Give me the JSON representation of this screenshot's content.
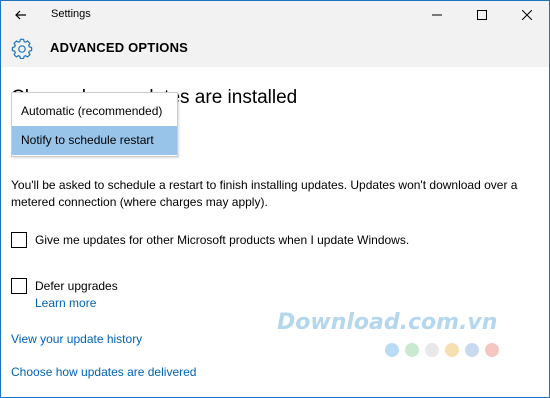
{
  "window": {
    "title": "Settings",
    "controls": {
      "minimize": "minimize-icon",
      "maximize": "maximize-icon",
      "close": "close-icon"
    }
  },
  "header": {
    "title": "ADVANCED OPTIONS",
    "icon": "gear-icon"
  },
  "main": {
    "heading": "Choose how updates are installed",
    "dropdown": {
      "options": [
        "Automatic (recommended)",
        "Notify to schedule restart"
      ],
      "selected": "Notify to schedule restart"
    },
    "description": "You'll be asked to schedule a restart to finish installing updates. Updates won't download over a metered connection (where charges may apply).",
    "checkboxes": [
      {
        "label": "Give me updates for other Microsoft products when I update Windows.",
        "checked": false
      },
      {
        "label": "Defer upgrades",
        "checked": false
      }
    ],
    "learn_more": "Learn more",
    "links": {
      "history": "View your update history",
      "delivered": "Choose how updates are delivered"
    }
  },
  "watermark": {
    "text": "Download.com.vn",
    "dot_colors": [
      "#b9dcf4",
      "#cbe8d0",
      "#e8e8e8",
      "#f6dfb0",
      "#c9daf0",
      "#f4c7c3"
    ]
  },
  "colors": {
    "accent_link": "#0063b1",
    "selection": "#98c4ea",
    "chrome_bg": "#f2f2f2"
  }
}
